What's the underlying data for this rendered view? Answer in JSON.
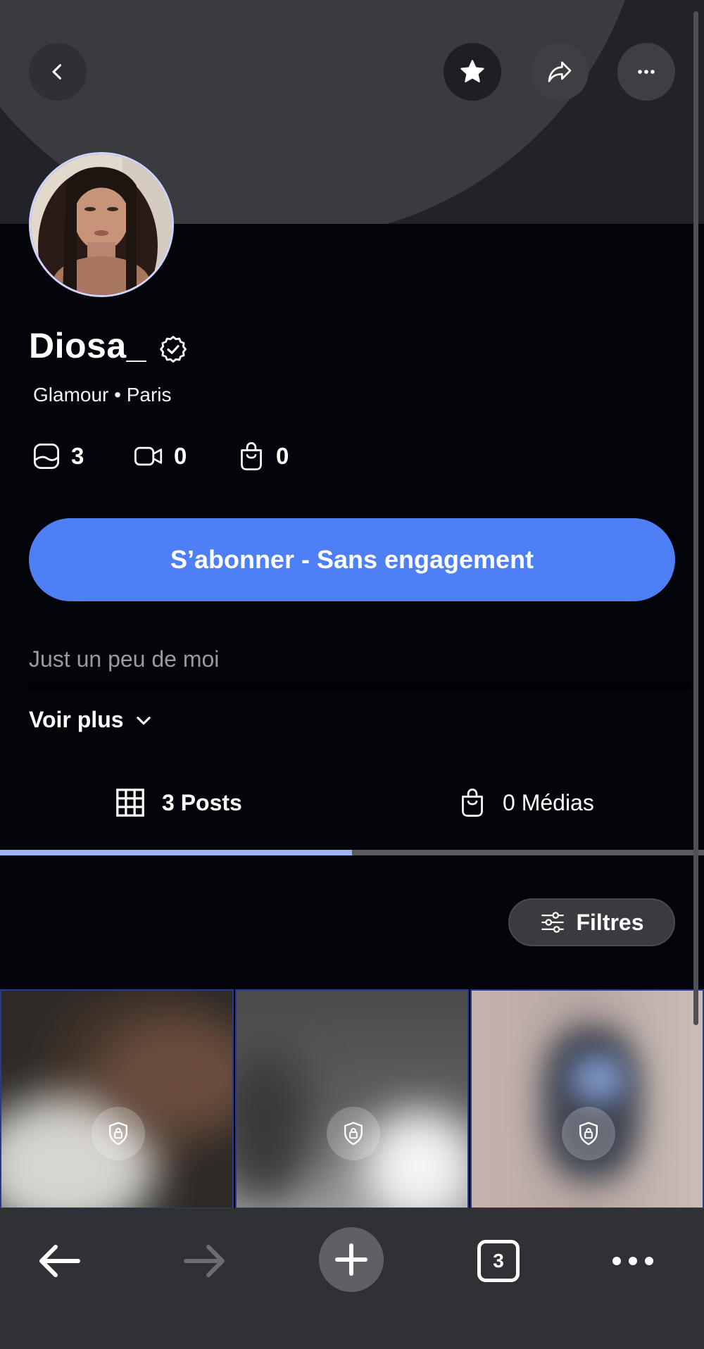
{
  "profile": {
    "name": "Diosa_",
    "subtitle": "Glamour • Paris",
    "stats": {
      "photos": "3",
      "videos": "0",
      "shop": "0"
    },
    "subscribe_label": "S’abonner - Sans engagement",
    "bio": "Just un peu de moi",
    "see_more_label": "Voir plus"
  },
  "tabs": [
    {
      "label": "3 Posts",
      "icon": "grid-icon",
      "active": true
    },
    {
      "label": "0 Médias",
      "icon": "bag-icon",
      "active": false
    }
  ],
  "filters_label": "Filtres",
  "posts": [
    {
      "locked": true
    },
    {
      "locked": true
    },
    {
      "locked": true
    }
  ],
  "browser": {
    "tab_count": "3"
  },
  "colors": {
    "accent": "#4f7ff5",
    "background": "#03050a",
    "tab_indicator": "#9eb3f5",
    "toolbar": "#303134"
  }
}
